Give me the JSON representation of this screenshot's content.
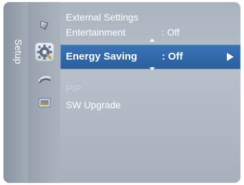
{
  "menu": {
    "side_tab_label": "Setup",
    "icons": {
      "picture": "picture-menu-icon",
      "setup": "setup-gear-icon",
      "input": "input-menu-icon",
      "application": "application-menu-icon"
    },
    "items": [
      {
        "name": "External Settings",
        "value": ""
      },
      {
        "name": "Entertainment",
        "value": ": Off"
      },
      {
        "name": "Energy Saving",
        "value": ": Off",
        "selected": true
      },
      {
        "name": "PIP",
        "value": "",
        "disabled": true
      },
      {
        "name": "SW Upgrade",
        "value": ""
      }
    ]
  },
  "colors": {
    "panel_gray": "#aab3bf",
    "selected_blue": "#336ab0",
    "text_white": "#ffffff"
  }
}
